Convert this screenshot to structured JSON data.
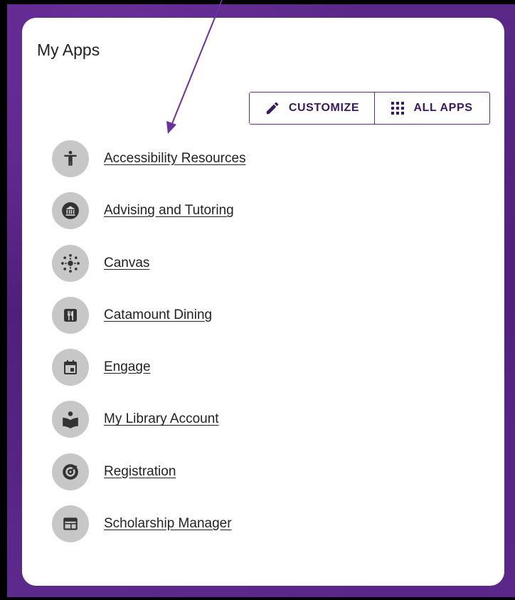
{
  "card": {
    "title": "My Apps"
  },
  "toolbar": {
    "customize_label": "CUSTOMIZE",
    "all_apps_label": "ALL APPS"
  },
  "apps": [
    {
      "label": "Accessibility Resources",
      "icon": "accessibility-icon"
    },
    {
      "label": "Advising and Tutoring",
      "icon": "building-icon"
    },
    {
      "label": "Canvas",
      "icon": "canvas-icon"
    },
    {
      "label": "Catamount Dining",
      "icon": "dining-icon"
    },
    {
      "label": "Engage",
      "icon": "calendar-icon"
    },
    {
      "label": "My Library Account",
      "icon": "reader-icon"
    },
    {
      "label": "Registration",
      "icon": "registration-icon"
    },
    {
      "label": "Scholarship Manager",
      "icon": "window-icon"
    }
  ],
  "colors": {
    "accent": "#5c2d91",
    "annotation_arrow": "#6b2fa0",
    "icon_bg": "#c7c7c7",
    "icon_fg": "#333333"
  }
}
